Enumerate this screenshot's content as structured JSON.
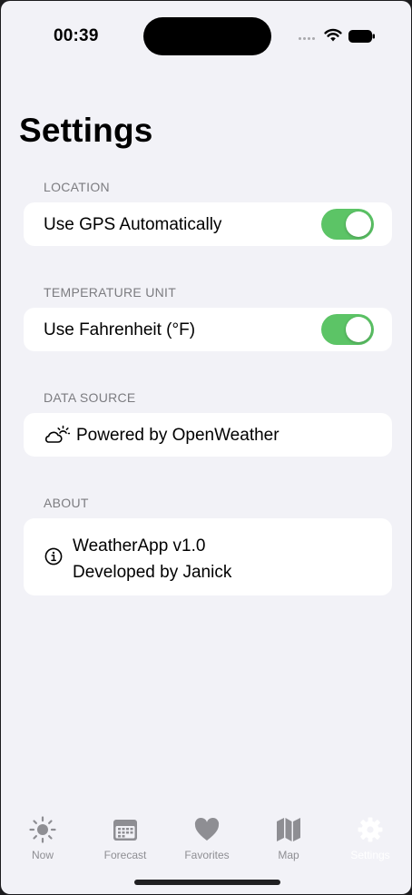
{
  "status_bar": {
    "time": "00:39"
  },
  "page": {
    "title": "Settings"
  },
  "sections": {
    "location": {
      "header": "LOCATION",
      "row_label": "Use GPS Automatically",
      "toggle_on": true
    },
    "temperature": {
      "header": "TEMPERATURE UNIT",
      "row_label": "Use Fahrenheit (°F)",
      "toggle_on": true
    },
    "data_source": {
      "header": "DATA SOURCE",
      "row_label": "Powered by OpenWeather",
      "icon": "cloud-sun-icon"
    },
    "about": {
      "header": "ABOUT",
      "line1": "WeatherApp v1.0",
      "line2": "Developed by Janick",
      "icon": "info-circle-icon"
    }
  },
  "tabbar": {
    "tabs": [
      {
        "label": "Now",
        "icon": "sun-icon"
      },
      {
        "label": "Forecast",
        "icon": "calendar-icon"
      },
      {
        "label": "Favorites",
        "icon": "heart-icon"
      },
      {
        "label": "Map",
        "icon": "map-icon"
      },
      {
        "label": "Settings",
        "icon": "gear-icon",
        "active": true
      }
    ]
  },
  "colors": {
    "accent_toggle": "#5cc466",
    "background": "#f2f2f7",
    "tab_inactive": "#8e8e93"
  }
}
